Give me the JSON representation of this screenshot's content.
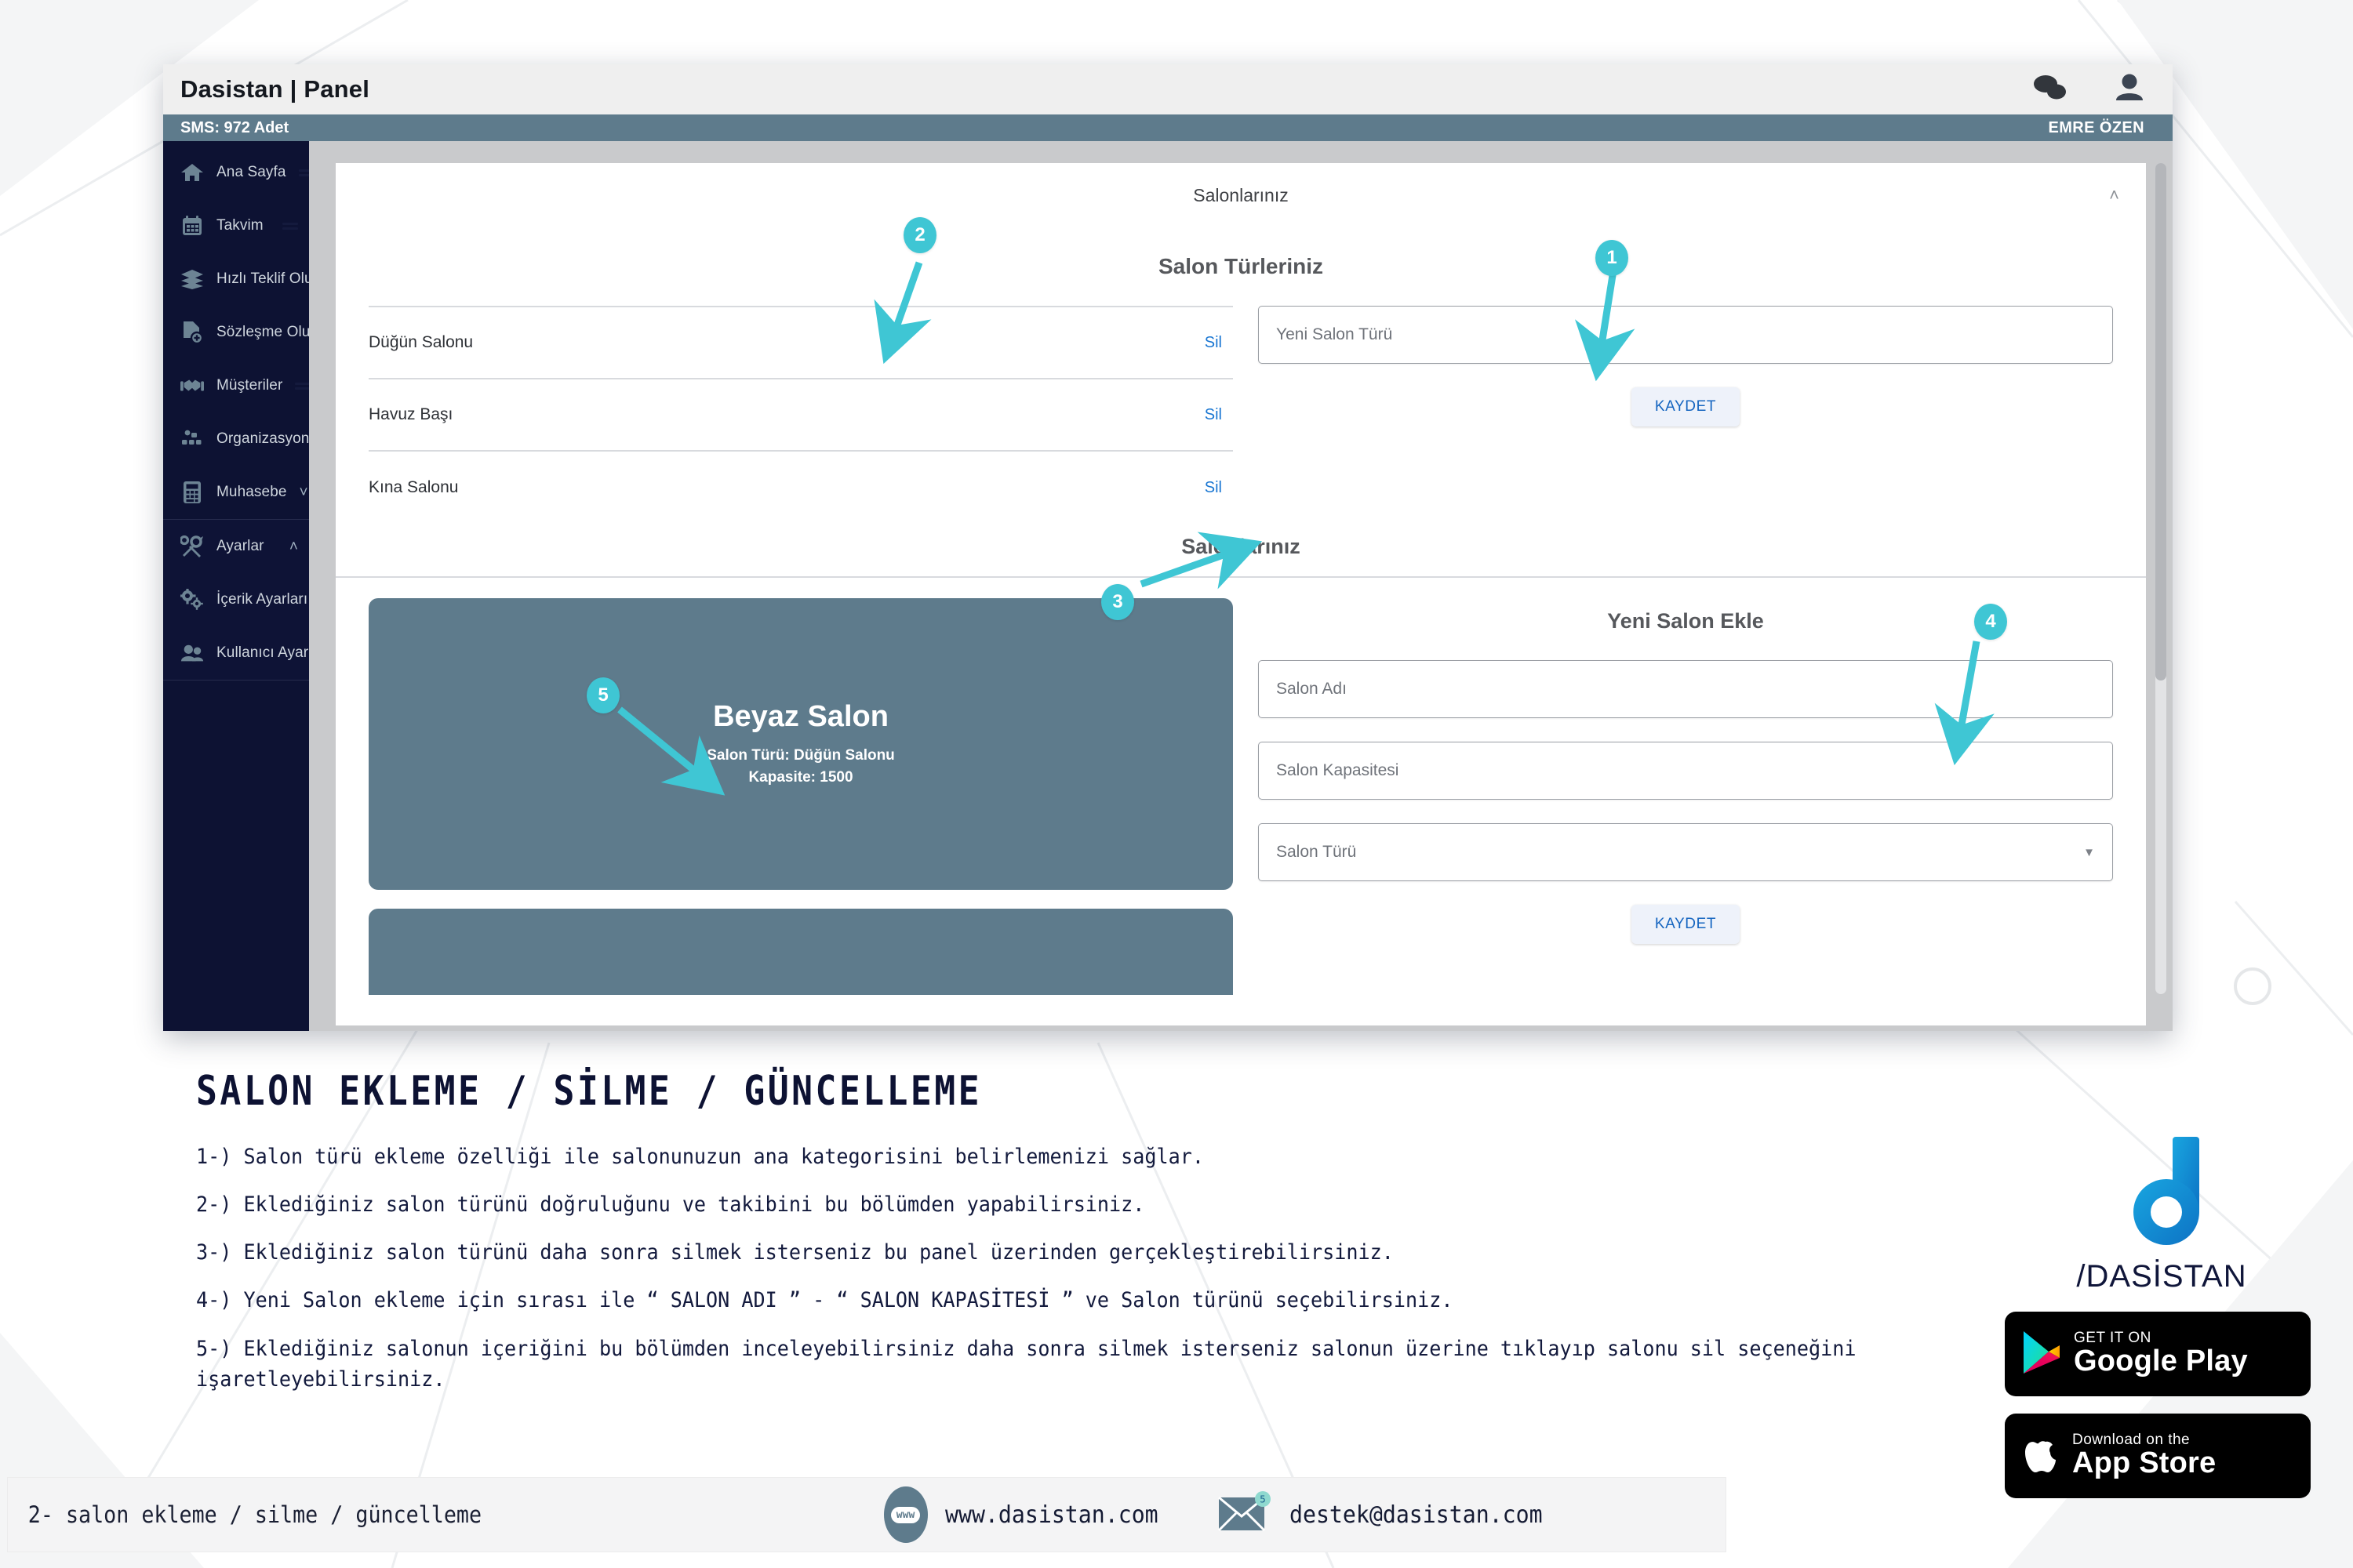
{
  "window": {
    "title": "Dasistan | Panel",
    "sms_counter": "SMS: 972 Adet",
    "user_name": "EMRE ÖZEN",
    "icons": {
      "chat": "chat-bubbles-icon",
      "user": "user-avatar-icon"
    }
  },
  "sidebar": {
    "items": [
      {
        "label": "Ana Sayfa",
        "icon": "home-icon",
        "expandable": false
      },
      {
        "label": "Takvim",
        "icon": "calendar-icon",
        "expandable": false
      },
      {
        "label": "Hızlı Teklif Oluştur",
        "icon": "layers-icon",
        "expandable": false
      },
      {
        "label": "Sözleşme Oluştur",
        "icon": "document-add-icon",
        "expandable": false
      },
      {
        "label": "Müşteriler",
        "icon": "handshake-icon",
        "expandable": false
      },
      {
        "label": "Organizasyon Oluştur",
        "icon": "sitemap-icon",
        "expandable": false
      },
      {
        "label": "Muhasebe",
        "icon": "calculator-icon",
        "expandable": true
      }
    ],
    "settings_group": [
      {
        "label": "Ayarlar",
        "icon": "tools-icon",
        "expandable": true,
        "expanded": true
      },
      {
        "label": "İçerik Ayarları",
        "icon": "gears-icon",
        "expandable": false
      },
      {
        "label": "Kullanıcı Ayarları",
        "icon": "users-icon",
        "expandable": false
      }
    ]
  },
  "panel": {
    "header_title": "Salonlarınız",
    "collapse_icon": "chevron-up-icon",
    "types_section_title": "Salon Türleriniz",
    "salon_types": [
      {
        "name": "Düğün Salonu",
        "delete_label": "Sil"
      },
      {
        "name": "Havuz Başı",
        "delete_label": "Sil"
      },
      {
        "name": "Kına Salonu",
        "delete_label": "Sil"
      }
    ],
    "new_type_input": {
      "placeholder": "Yeni Salon Türü",
      "value": ""
    },
    "new_type_save": "KAYDET",
    "salons_section_title": "Salonlarınız",
    "salon_cards": [
      {
        "name": "Beyaz Salon",
        "type_line": "Salon Türü: Düğün Salonu",
        "capacity_line": "Kapasite: 1500"
      }
    ],
    "add_salon": {
      "title": "Yeni Salon Ekle",
      "fields": [
        {
          "placeholder": "Salon Adı",
          "value": "",
          "type": "text"
        },
        {
          "placeholder": "Salon Kapasitesi",
          "value": "",
          "type": "text"
        },
        {
          "placeholder": "Salon Türü",
          "value": "",
          "type": "select"
        }
      ],
      "save_label": "KAYDET"
    }
  },
  "callouts": [
    {
      "n": "1"
    },
    {
      "n": "2"
    },
    {
      "n": "3"
    },
    {
      "n": "4"
    },
    {
      "n": "5"
    }
  ],
  "caption": {
    "title": "SALON EKLEME / SİLME / GÜNCELLEME",
    "items": [
      "1-) Salon türü ekleme özelliği ile salonunuzun ana kategorisini belirlemenizi sağlar.",
      "2-) Eklediğiniz salon türünü doğruluğunu ve takibini bu bölümden yapabilirsiniz.",
      "3-) Eklediğiniz salon türünü daha sonra silmek isterseniz bu panel üzerinden gerçekleştirebilirsiniz.",
      "4-) Yeni Salon ekleme için sırası ile “ SALON ADI ” - “ SALON KAPASİTESİ ” ve Salon türünü seçebilirsiniz.",
      "5-) Eklediğiniz salonun içeriğini bu bölümden inceleyebilirsiniz daha sonra silmek isterseniz salonun üzerine tıklayıp salonu sil seçeneğini işaretleyebilirsiniz."
    ]
  },
  "brand": {
    "wordmark": "/DASİSTAN",
    "logo_color": "#1193d6",
    "google_play": {
      "small": "GET IT ON",
      "big": "Google Play"
    },
    "app_store": {
      "small": "Download on the",
      "big": "App Store"
    }
  },
  "footer": {
    "page_label": "2- salon ekleme / silme / güncelleme",
    "website": "www.dasistan.com",
    "email": "destek@dasistan.com",
    "www_text": "www"
  },
  "colors": {
    "accent": "#3fc6d4",
    "sidebar": "#0d1233",
    "subbar": "#5e7b8c",
    "link": "#1976d2",
    "card": "#5e7b8c"
  }
}
